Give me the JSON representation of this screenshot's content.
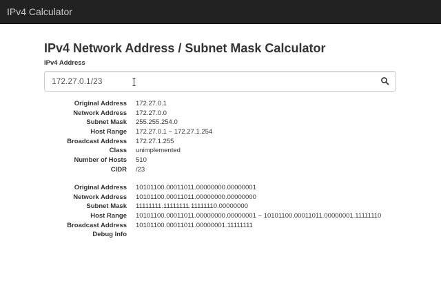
{
  "navbar": {
    "brand": "IPv4 Calculator"
  },
  "main": {
    "title": "IPv4 Network Address / Subnet Mask Calculator",
    "input_label": "IPv4 Address",
    "input_value": "172.27.0.1/23",
    "search_icon": "search-icon"
  },
  "summary": [
    {
      "label": "Original Address",
      "value": "172.27.0.1"
    },
    {
      "label": "Network Address",
      "value": "172.27.0.0"
    },
    {
      "label": "Subnet Mask",
      "value": "255.255.254.0"
    },
    {
      "label": "Host Range",
      "value": "172.27.0.1 ~ 172.27.1.254"
    },
    {
      "label": "Broadcast Address",
      "value": "172.27.1.255"
    },
    {
      "label": "Class",
      "value": "unimplemented"
    },
    {
      "label": "Number of Hosts",
      "value": "510"
    },
    {
      "label": "CIDR",
      "value": "/23"
    }
  ],
  "binary": [
    {
      "label": "Original Address",
      "value": "10101100.00011011.00000000.00000001"
    },
    {
      "label": "Network Address",
      "value": "10101100.00011011.00000000.00000000"
    },
    {
      "label": "Subnet Mask",
      "value": "11111111.11111111.11111110.00000000"
    },
    {
      "label": "Host Range",
      "value": "10101100.00011011.00000000.00000001 ~ 10101100.00011011.00000001.11111110"
    },
    {
      "label": "Broadcast Address",
      "value": "10101100.00011011.00000001.11111111"
    },
    {
      "label": "Debug Info",
      "value": ""
    }
  ]
}
